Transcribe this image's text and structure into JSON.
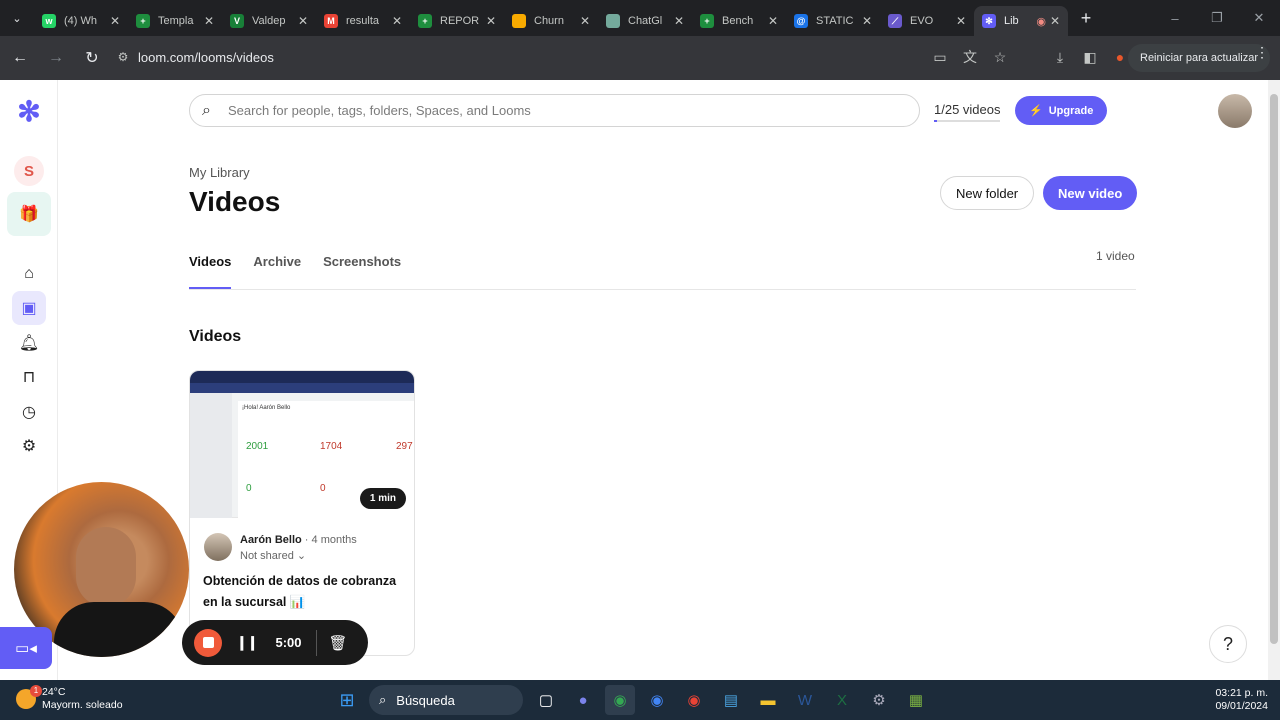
{
  "browser": {
    "tabs": [
      {
        "label": "(4) Wh",
        "color": "#25d366",
        "glyph": "w"
      },
      {
        "label": "Templa",
        "color": "#1e8e3e",
        "glyph": "+"
      },
      {
        "label": "Valdep",
        "color": "#188038",
        "glyph": "V"
      },
      {
        "label": "resulta",
        "color": "#ea4335",
        "glyph": "M"
      },
      {
        "label": "REPOR",
        "color": "#1e8e3e",
        "glyph": "+"
      },
      {
        "label": "Churn",
        "color": "#f9ab00",
        "glyph": ""
      },
      {
        "label": "ChatGl",
        "color": "#74aa9c",
        "glyph": ""
      },
      {
        "label": "Bench",
        "color": "#1e8e3e",
        "glyph": "+"
      },
      {
        "label": "STATIC",
        "color": "#1a73e8",
        "glyph": "@"
      },
      {
        "label": "EVO",
        "color": "#6a5acd",
        "glyph": "⟋"
      },
      {
        "label": "Lib",
        "color": "#625df5",
        "glyph": "✻",
        "active": true
      }
    ],
    "url": "loom.com/looms/videos",
    "restart_label": "Reiniciar para actualizar"
  },
  "header": {
    "search_placeholder": "Search for people, tags, folders, Spaces, and Looms",
    "video_count": "1/25 videos",
    "video_count_fraction": 0.04,
    "upgrade_label": "Upgrade"
  },
  "sidebar": {
    "workspace_initial": "S"
  },
  "page": {
    "breadcrumb": "My Library",
    "title": "Videos",
    "new_folder_label": "New folder",
    "new_video_label": "New video",
    "tabs": [
      "Videos",
      "Archive",
      "Screenshots"
    ],
    "active_tab": "Videos",
    "count_label": "1 video",
    "section_title": "Videos"
  },
  "video": {
    "duration": "1 min",
    "author": "Aarón Bello",
    "age": "4 months",
    "share_status": "Not shared",
    "title": "Obtención de datos de cobranza en la sucursal 📊",
    "thumb_values": [
      "2001",
      "1704",
      "297",
      "0",
      "0"
    ],
    "thumb_heading": "¡Hola! Aarón Bello"
  },
  "recorder": {
    "timer": "5:00"
  },
  "taskbar": {
    "temp": "24°C",
    "weather": "Mayorm. soleado",
    "notification_count": "1",
    "search_label": "Búsqueda",
    "time": "03:21 p. m.",
    "date": "09/01/2024"
  },
  "colors": {
    "accent": "#625df5",
    "record": "#f05a3a"
  }
}
